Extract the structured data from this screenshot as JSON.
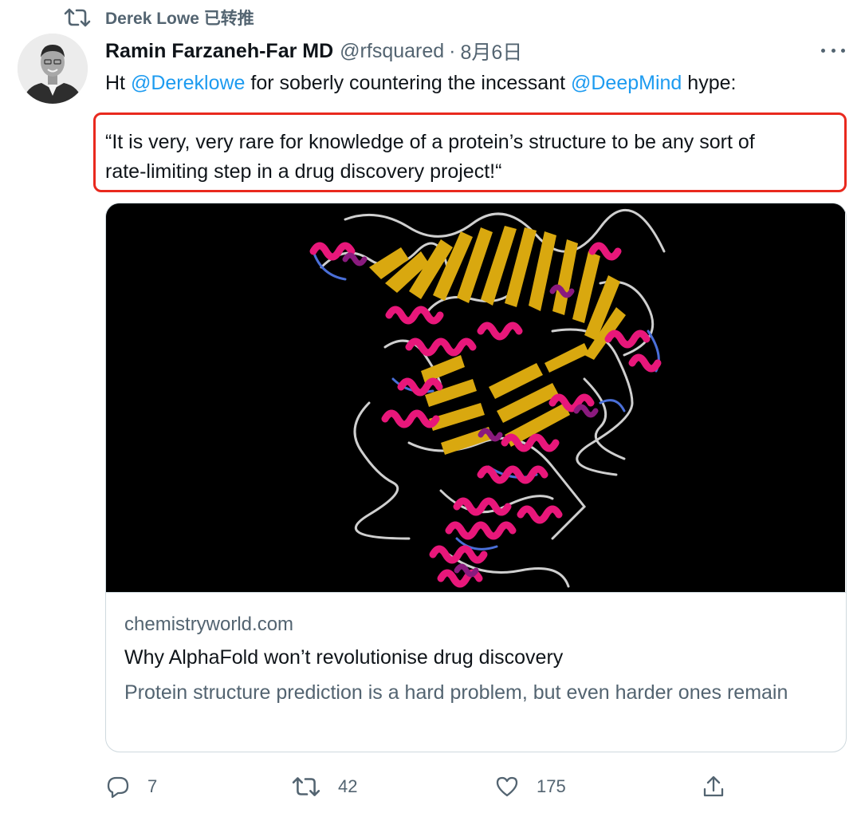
{
  "retweet": {
    "icon": "retweet-icon",
    "text": "Derek Lowe 已转推"
  },
  "tweet": {
    "author_name": "Ramin Farzaneh-Far MD",
    "handle": "@rfsquared",
    "separator": "·",
    "date": "8月6日",
    "text_part1": "Ht ",
    "mention1": "@Dereklowe",
    "text_part2": " for soberly countering the incessant ",
    "mention2": "@DeepMind",
    "text_part3": " hype:",
    "quote_line1": "“It is very, very rare for knowledge of a protein’s structure to be any sort of",
    "quote_line2": "rate-limiting step in a drug discovery project!“"
  },
  "card": {
    "domain": "chemistryworld.com",
    "title": "Why AlphaFold won’t revolutionise drug discovery",
    "description": "Protein structure prediction is a hard problem, but even harder ones remain"
  },
  "actions": {
    "reply_count": "7",
    "retweet_count": "42",
    "like_count": "175"
  },
  "colors": {
    "accent": "#1d9bf0",
    "secondary_text": "#536471",
    "highlight_border": "#e9291e",
    "helix": "#e8177a",
    "sheet": "#d9a80f",
    "loop": "#e6e6e6",
    "loop_blue": "#4a6fd8"
  }
}
